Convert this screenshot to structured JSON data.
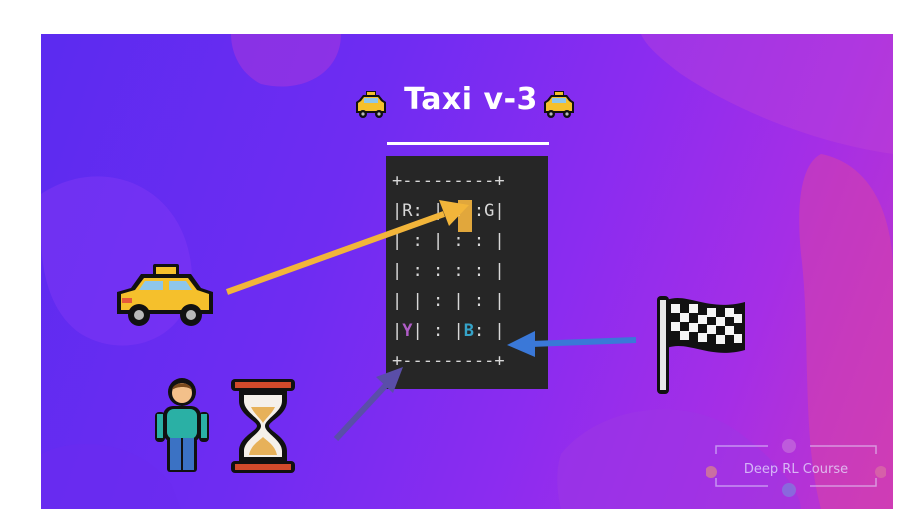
{
  "title": "Taxi v-3",
  "grid": {
    "rows": [
      "+---------+",
      "|R: | : :G|",
      "| : | : : |",
      "| : : : : |",
      "| | : | : |",
      "|Y| : |B: |",
      "+---------+"
    ],
    "locations": [
      "R",
      "G",
      "Y",
      "B"
    ],
    "colors": {
      "Y": "#b05cc7",
      "B": "#35a3c8",
      "taxi": "#e1a73c"
    }
  },
  "icons": {
    "taxi": "taxi-icon",
    "passenger": "person-icon",
    "time": "hourglass-icon",
    "destination": "checkered-flag-icon"
  },
  "arrows": {
    "taxi": "#f2b53a",
    "passenger": "#5a4ea8",
    "destination": "#3a78d8"
  },
  "watermark": {
    "label": "Deep RL Course"
  }
}
